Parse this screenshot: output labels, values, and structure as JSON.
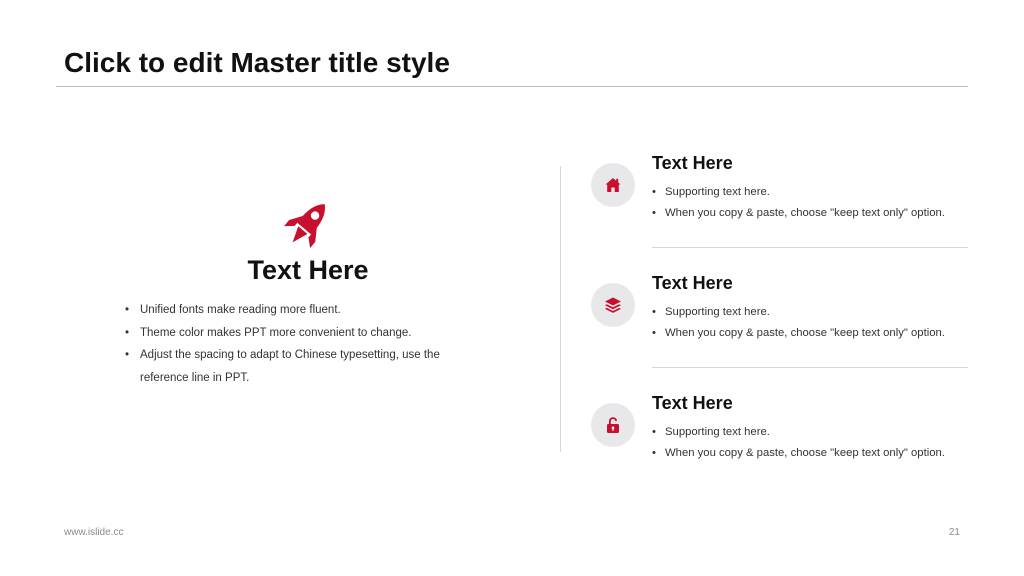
{
  "slide": {
    "title": "Click to edit Master title style",
    "accent_color": "#c8102e",
    "icon_background": "#e8e8ea"
  },
  "left_panel": {
    "icon": "rocket-icon",
    "heading": "Text Here",
    "bullets": [
      "Unified fonts make reading more fluent.",
      "Theme color makes PPT more convenient to change.",
      "Adjust the spacing to adapt to Chinese typesetting, use the reference line in PPT."
    ]
  },
  "items": [
    {
      "icon": "home-icon",
      "heading": "Text Here",
      "bullets": [
        "Supporting text here.",
        "When you copy & paste, choose \"keep text only\" option."
      ]
    },
    {
      "icon": "layers-icon",
      "heading": "Text Here",
      "bullets": [
        "Supporting text here.",
        "When you copy & paste, choose \"keep text only\" option."
      ]
    },
    {
      "icon": "unlock-icon",
      "heading": "Text Here",
      "bullets": [
        "Supporting text here.",
        "When you copy & paste, choose \"keep text only\" option."
      ]
    }
  ],
  "footer": {
    "url": "www.islide.cc",
    "page_number": "21"
  }
}
